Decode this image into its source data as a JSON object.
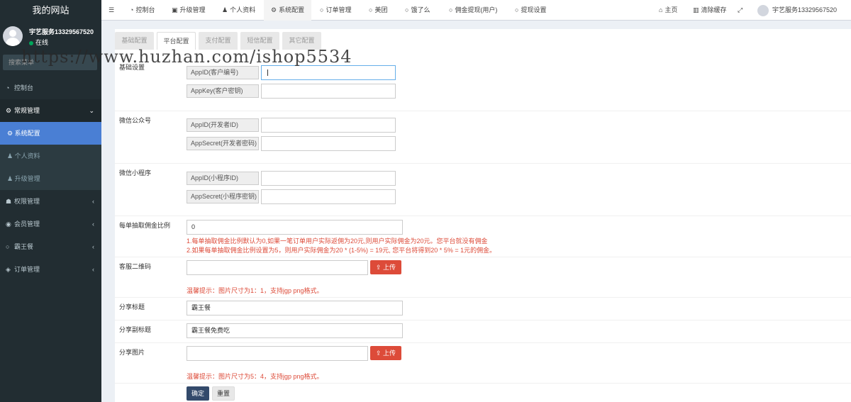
{
  "site_title": "我的网站",
  "user": {
    "name": "宇艺服务13329567520",
    "status": "在线"
  },
  "search_placeholder": "搜索菜单",
  "watermark": "https://www.huzhan.com/ishop5534",
  "sidebar": {
    "items": [
      {
        "label": "控制台",
        "icon": "dashboard-icon"
      },
      {
        "label": "常规管理",
        "icon": "cogs-icon"
      },
      {
        "label": "系统配置",
        "icon": "gear-icon"
      },
      {
        "label": "个人资料",
        "icon": "user-icon"
      },
      {
        "label": "升级管理",
        "icon": "user-icon"
      },
      {
        "label": "权限管理",
        "icon": "group-icon"
      },
      {
        "label": "会员管理",
        "icon": "user-circle-icon"
      },
      {
        "label": "霸王餐",
        "icon": "circle-icon"
      },
      {
        "label": "订单管理",
        "icon": "cube-icon"
      }
    ]
  },
  "topbar": {
    "tabs": [
      "控制台",
      "升级管理",
      "个人资料",
      "系统配置",
      "订单管理",
      "美团",
      "饿了么",
      "佣金提现(用户)",
      "提现设置"
    ],
    "home": "主页",
    "clear_cache": "清除缓存",
    "user_name": "宇艺服务13329567520"
  },
  "content_tabs": [
    "基础配置",
    "平台配置",
    "支付配置",
    "短信配置",
    "其它配置"
  ],
  "sections": {
    "basic": {
      "label": "基础设置",
      "fields": [
        {
          "addon": "AppID(客户编号)",
          "value": ""
        },
        {
          "addon": "AppKey(客户密钥)",
          "value": ""
        }
      ]
    },
    "wechat_mp": {
      "label": "微信公众号",
      "fields": [
        {
          "addon": "AppID(开发者ID)",
          "value": ""
        },
        {
          "addon": "AppSecret(开发者密码)",
          "value": ""
        }
      ]
    },
    "wechat_mini": {
      "label": "微信小程序",
      "fields": [
        {
          "addon": "AppID(小程序ID)",
          "value": ""
        },
        {
          "addon": "AppSecret(小程序密钥)",
          "value": ""
        }
      ]
    },
    "commission": {
      "label": "每单抽取佣金比例",
      "value": "0",
      "hint1": "1.每单抽取佣金比例默认为0,如果一笔订单用户实际返佣为20元,则用户实际佣金为20元。您平台就没有佣金",
      "hint2": "2.如果每单抽取佣金比例设置为5，则用户实际佣金为20 * (1-5%) = 19元, 您平台将得到20 * 5% = 1元的佣金。"
    },
    "qrcode": {
      "label": "客服二维码",
      "value": "",
      "upload": "上传",
      "hint": "温馨提示：图片尺寸为1：1，支持jgp png格式。"
    },
    "share_title": {
      "label": "分享标题",
      "value": "霸王餐"
    },
    "share_subtitle": {
      "label": "分享副标题",
      "value": "霸王餐免费吃"
    },
    "share_image": {
      "label": "分享图片",
      "value": "",
      "upload": "上传",
      "hint": "温馨提示：图片尺寸为5：4，支持jgp png格式。"
    }
  },
  "buttons": {
    "ok": "确定",
    "reset": "重置"
  }
}
